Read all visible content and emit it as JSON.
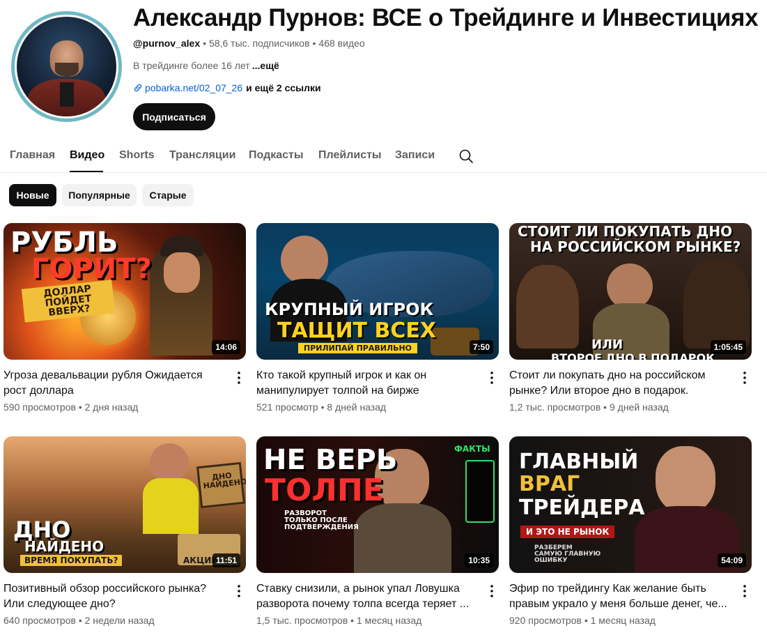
{
  "channel": {
    "title": "Александр Пурнов: ВСЕ о Трейдинге и Инвестициях",
    "handle": "@purnov_alex",
    "subscribers": "58,6 тыс. подписчиков",
    "videos_count": "468 видео",
    "description": "В трейдинге более 16 лет",
    "description_more": "...ещё",
    "link": "pobarka.net/02_07_26",
    "more_links": "и ещё 2 ссылки",
    "subscribe_label": "Подписаться",
    "avatar_ring_color": "#6fb8c4"
  },
  "tabs": [
    {
      "label": "Главная",
      "active": false
    },
    {
      "label": "Видео",
      "active": true
    },
    {
      "label": "Shorts",
      "active": false
    },
    {
      "label": "Трансляции",
      "active": false
    },
    {
      "label": "Подкасты",
      "active": false
    },
    {
      "label": "Плейлисты",
      "active": false
    },
    {
      "label": "Записи",
      "active": false
    }
  ],
  "chips": [
    {
      "label": "Новые",
      "active": true
    },
    {
      "label": "Популярные",
      "active": false
    },
    {
      "label": "Старые",
      "active": false
    }
  ],
  "videos": [
    {
      "title": "Угроза девальвации рубля  Ожидается рост доллара",
      "views": "590 просмотров",
      "age": "2 дня назад",
      "duration": "14:06",
      "thumb_text": [
        "РУБЛЬ",
        "ГОРИТ?",
        "ДОЛЛАР ПОЙДЕТ ВВЕРХ?"
      ]
    },
    {
      "title": "Кто такой крупный игрок и как он манипулирует толпой на бирже",
      "views": "521 просмотр",
      "age": "8 дней назад",
      "duration": "7:50",
      "thumb_text": [
        "КРУПНЫЙ ИГРОК",
        "ТАЩИТ ВСЕХ",
        "ПРИЛИПАЙ ПРАВИЛЬНО"
      ]
    },
    {
      "title": "Стоит ли покупать дно на российском рынке? Или второе дно в подарок.",
      "views": "1,2 тыс. просмотров",
      "age": "9 дней назад",
      "duration": "1:05:45",
      "thumb_text": [
        "СТОИТ ЛИ ПОКУПАТЬ ДНО",
        "НА РОССИЙСКОМ РЫНКЕ?",
        "ИЛИ",
        "ВТОРОЕ ДНО В ПОДАРОК"
      ]
    },
    {
      "title": "Позитивный обзор российского рынка? Или следующее дно?",
      "views": "640 просмотров",
      "age": "2 недели назад",
      "duration": "11:51",
      "thumb_text": [
        "ДНО",
        "НАЙДЕНО",
        "ВРЕМЯ ПОКУПАТЬ?",
        "ДНО НАЙДЕНО",
        "АКЦИИ"
      ]
    },
    {
      "title": "Ставку снизили, а рынок упал  Ловушка разворота почему толпа всегда теряет ...",
      "views": "1,5 тыс. просмотров",
      "age": "1 месяц назад",
      "duration": "10:35",
      "thumb_text": [
        "НЕ ВЕРЬ",
        "ТОЛПЕ",
        "РАЗВОРОТ ТОЛЬКО ПОСЛЕ ПОДТВЕРЖДЕНИЯ",
        "ФАКТЫ"
      ]
    },
    {
      "title": "Эфир по трейдингу  Как желание быть правым украло у меня больше денег, че...",
      "views": "920 просмотров",
      "age": "1 месяц назад",
      "duration": "54:09",
      "thumb_text": [
        "ГЛАВНЫЙ",
        "ВРАГ",
        "ТРЕЙДЕРА",
        "И ЭТО НЕ РЫНОК",
        "РАЗБЕРЕМ САМУЮ ГЛАВНУЮ ОШИБКУ"
      ]
    }
  ]
}
